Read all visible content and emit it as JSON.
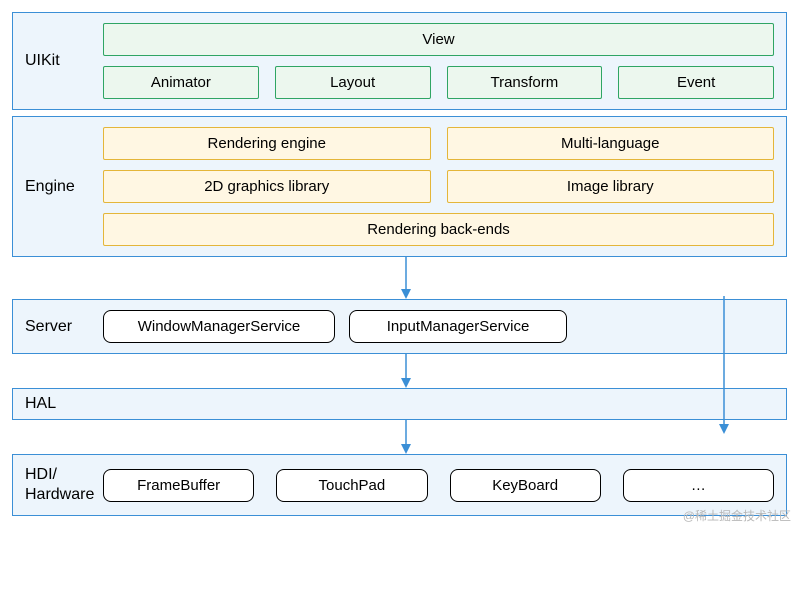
{
  "watermark": "@稀土掘金技术社区",
  "layers": {
    "uikit": {
      "label": "UIKit",
      "view": "View",
      "animator": "Animator",
      "layout": "Layout",
      "transform": "Transform",
      "event": "Event"
    },
    "engine": {
      "label": "Engine",
      "rendering_engine": "Rendering engine",
      "multi_language": "Multi-language",
      "graphics2d": "2D graphics library",
      "image_library": "Image library",
      "rendering_backends": "Rendering back-ends"
    },
    "server": {
      "label": "Server",
      "wms": "WindowManagerService",
      "ims": "InputManagerService"
    },
    "hal": {
      "label": "HAL"
    },
    "hdi": {
      "label": "HDI/\nHardware",
      "framebuffer": "FrameBuffer",
      "touchpad": "TouchPad",
      "keyboard": "KeyBoard",
      "more": "…"
    }
  }
}
